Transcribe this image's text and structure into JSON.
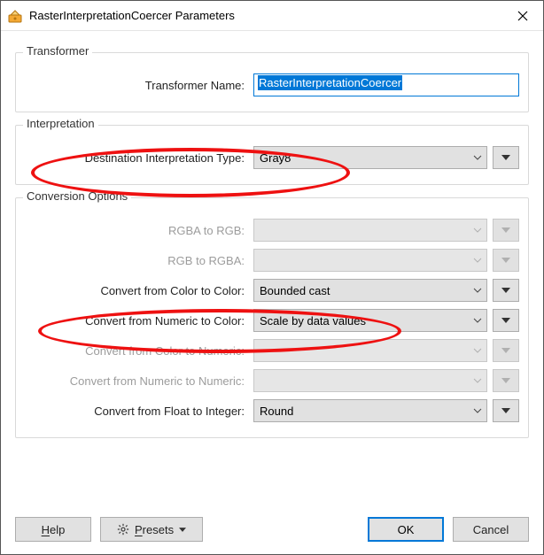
{
  "window": {
    "title": "RasterInterpretationCoercer Parameters"
  },
  "groups": {
    "transformer": {
      "legend": "Transformer",
      "name_label": "Transformer Name:",
      "name_value": "RasterInterpretationCoercer"
    },
    "interpretation": {
      "legend": "Interpretation",
      "dest_label": "Destination Interpretation Type:",
      "dest_value": "Gray8"
    },
    "conversion": {
      "legend": "Conversion Options",
      "rgba_to_rgb_label": "RGBA to RGB:",
      "rgba_to_rgb_value": "",
      "rgb_to_rgba_label": "RGB to RGBA:",
      "rgb_to_rgba_value": "",
      "color_to_color_label": "Convert from Color to Color:",
      "color_to_color_value": "Bounded cast",
      "numeric_to_color_label": "Convert from Numeric to Color:",
      "numeric_to_color_value": "Scale by data values",
      "color_to_numeric_label": "Convert from Color to Numeric:",
      "color_to_numeric_value": "",
      "numeric_to_numeric_label": "Convert from Numeric to Numeric:",
      "numeric_to_numeric_value": "",
      "float_to_int_label": "Convert from Float to Integer:",
      "float_to_int_value": "Round"
    }
  },
  "buttons": {
    "help": "Help",
    "presets": "Presets",
    "ok": "OK",
    "cancel": "Cancel"
  }
}
